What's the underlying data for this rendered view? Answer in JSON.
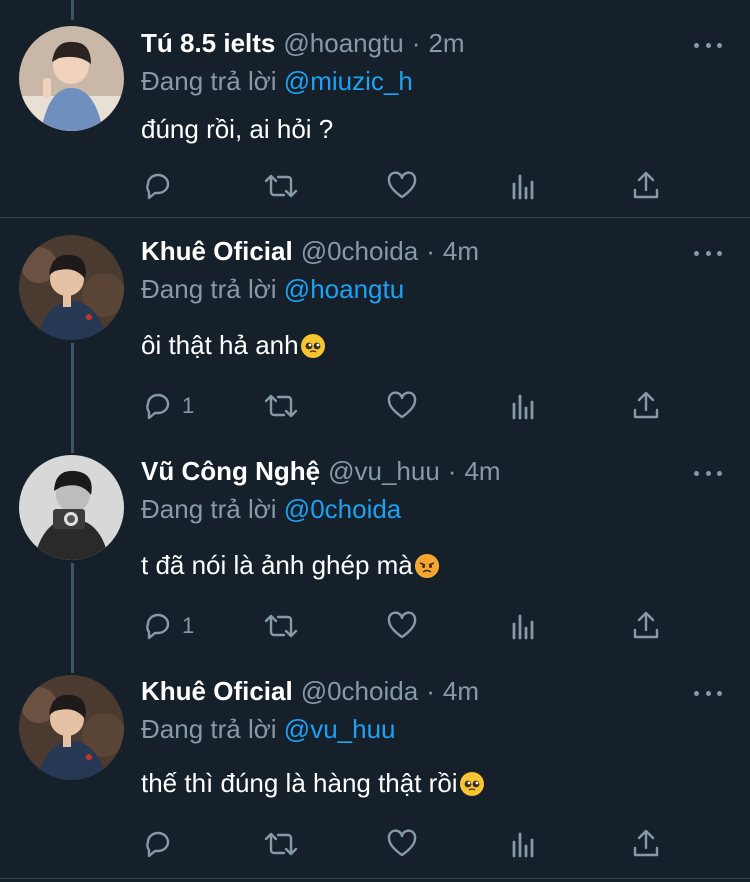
{
  "reply_prefix": "Đang trả lời",
  "tweets": [
    {
      "name": "Tú 8.5 ielts",
      "handle": "@hoangtu",
      "time": "2m",
      "reply_to": "@miuzic_h",
      "text": "đúng rồi, ai hỏi ?",
      "emoji": "",
      "reply_count": ""
    },
    {
      "name": "Khuê Oficial",
      "handle": "@0choida",
      "time": "4m",
      "reply_to": "@hoangtu",
      "text": "ôi thật hả anh",
      "emoji": "pleading-face",
      "reply_count": "1"
    },
    {
      "name": "Vũ Công Nghệ",
      "handle": "@vu_huu",
      "time": "4m",
      "reply_to": "@0choida",
      "text": "t đã nói là ảnh ghép mà",
      "emoji": "angry-face",
      "reply_count": "1"
    },
    {
      "name": "Khuê Oficial",
      "handle": "@0choida",
      "time": "4m",
      "reply_to": "@vu_huu",
      "text": "thế thì đúng là hàng thật rồi",
      "emoji": "pleading-face",
      "reply_count": ""
    }
  ],
  "colors": {
    "background": "#15202b",
    "text": "#ffffff",
    "secondary": "#8899a6",
    "mention": "#1da1f2",
    "divider": "#38444d"
  }
}
